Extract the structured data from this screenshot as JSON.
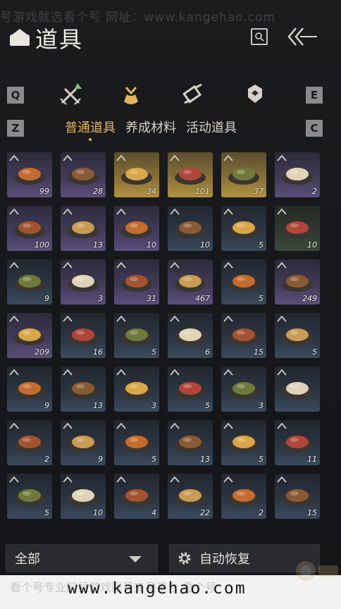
{
  "header": {
    "title": "道具",
    "watermark_top": "号游戏就选看个号  网址：www.kangehao.com"
  },
  "category_tabs": {
    "left_key": "Q",
    "right_key": "E",
    "icons": [
      "weapons-icon",
      "items-pouch-icon",
      "scroll-icon",
      "badge-icon"
    ],
    "active_index": 1
  },
  "sub_tabs": {
    "left_key": "Z",
    "right_key": "C",
    "labels": [
      "普通道具",
      "养成材料",
      "活动道具"
    ],
    "active_index": 0
  },
  "items": [
    {
      "count": "99",
      "quality": "purple",
      "icon": "jade-coin-icon"
    },
    {
      "count": "28",
      "quality": "purple",
      "icon": "red-envelope-icon"
    },
    {
      "count": "34",
      "quality": "gold",
      "icon": "bronze-cauldron-icon"
    },
    {
      "count": "101",
      "quality": "gold",
      "icon": "gold-ingot-icon"
    },
    {
      "count": "37",
      "quality": "gold",
      "icon": "copper-coin-icon"
    },
    {
      "count": "2",
      "quality": "purple",
      "icon": "rice-balls-icon"
    },
    {
      "count": "100",
      "quality": "purple",
      "icon": "soup-bowl-icon"
    },
    {
      "count": "13",
      "quality": "purple",
      "icon": "braised-meat-icon"
    },
    {
      "count": "10",
      "quality": "purple",
      "icon": "tomato-egg-icon"
    },
    {
      "count": "10",
      "quality": "blue",
      "icon": "fish-dish-icon"
    },
    {
      "count": "5",
      "quality": "blue",
      "icon": "meat-skewer-icon"
    },
    {
      "count": "10",
      "quality": "green",
      "icon": "clay-pot-icon"
    },
    {
      "count": "9",
      "quality": "blue",
      "icon": "dumplings-icon"
    },
    {
      "count": "3",
      "quality": "purple",
      "icon": "braised-pork-icon"
    },
    {
      "count": "31",
      "quality": "purple",
      "icon": "stew-bowl-icon"
    },
    {
      "count": "467",
      "quality": "purple",
      "icon": "meatballs-icon"
    },
    {
      "count": "5",
      "quality": "blue",
      "icon": "noodles-icon"
    },
    {
      "count": "249",
      "quality": "purple",
      "icon": "roast-leg-icon"
    },
    {
      "count": "209",
      "quality": "purple",
      "icon": "fried-dough-icon"
    },
    {
      "count": "16",
      "quality": "blue",
      "icon": "sliced-meat-icon"
    },
    {
      "count": "5",
      "quality": "blue",
      "icon": "mixed-dish-icon"
    },
    {
      "count": "6",
      "quality": "blue",
      "icon": "pork-plate-icon"
    },
    {
      "count": "15",
      "quality": "blue",
      "icon": "steamed-bun-icon"
    },
    {
      "count": "5",
      "quality": "blue",
      "icon": "noodle-soup-icon"
    },
    {
      "count": "9",
      "quality": "blue",
      "icon": "stir-fry-icon"
    },
    {
      "count": "13",
      "quality": "blue",
      "icon": "porridge-icon"
    },
    {
      "count": "3",
      "quality": "blue",
      "icon": "seafood-plate-icon"
    },
    {
      "count": "5",
      "quality": "blue",
      "icon": "spicy-dish-icon"
    },
    {
      "count": "3",
      "quality": "blue",
      "icon": "rice-bowl-icon"
    },
    {
      "count": "",
      "quality": "blue",
      "icon": "wine-bottle-icon"
    },
    {
      "count": "2",
      "quality": "blue",
      "icon": "fried-rice-icon"
    },
    {
      "count": "9",
      "quality": "blue",
      "icon": "greens-plate-icon"
    },
    {
      "count": "5",
      "quality": "blue",
      "icon": "tofu-dish-icon"
    },
    {
      "count": "13",
      "quality": "blue",
      "icon": "chili-dish-icon"
    },
    {
      "count": "5",
      "quality": "blue",
      "icon": "hotpot-icon"
    },
    {
      "count": "11",
      "quality": "blue",
      "icon": "pork-belly-icon"
    },
    {
      "count": "5",
      "quality": "blue",
      "icon": "egg-custard-icon"
    },
    {
      "count": "10",
      "quality": "blue",
      "icon": "fried-balls-icon"
    },
    {
      "count": "4",
      "quality": "blue",
      "icon": "mushroom-dish-icon"
    },
    {
      "count": "22",
      "quality": "blue",
      "icon": "scrambled-egg-icon"
    },
    {
      "count": "2",
      "quality": "blue",
      "icon": "layer-cake-icon"
    },
    {
      "count": "15",
      "quality": "blue",
      "icon": "sweet-dumpling-icon"
    }
  ],
  "filter_select": {
    "value": "全部"
  },
  "auto_restore": {
    "label": "自动恢复"
  },
  "footer": {
    "faint_text": "看个号专业网易游戏账号交易平台  看个号",
    "url": "www.kangehao.com"
  },
  "colors": {
    "accent_gold": "#e3b55d",
    "quality_gold": "#b2933f",
    "quality_purple": "#5b4f7d",
    "quality_blue": "#3a4b5e"
  }
}
